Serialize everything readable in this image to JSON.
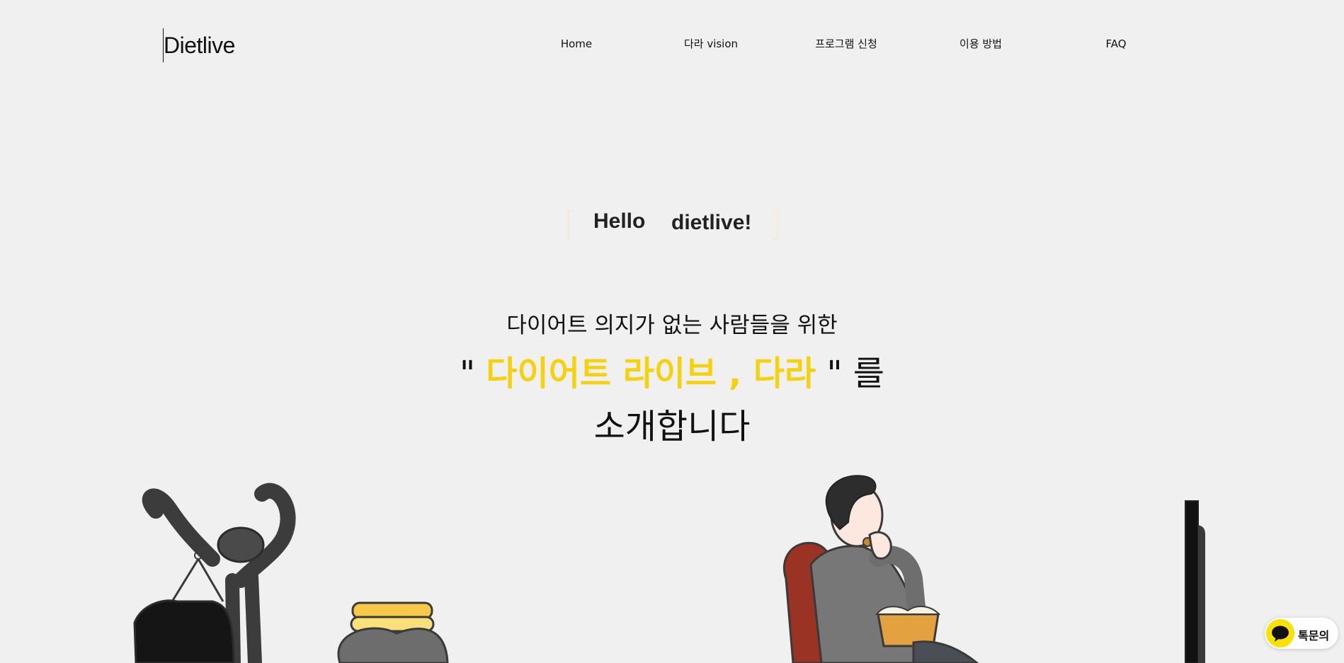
{
  "header": {
    "logo": "Dietlive",
    "nav": [
      "Home",
      "다라 vision",
      "프로그램 신청",
      "이용 방법",
      "FAQ"
    ]
  },
  "hero": {
    "bracket_open": "[",
    "bracket_close": "]",
    "hello_word1": "Hello",
    "hello_word2": "dietlive!",
    "line1": "다이어트 의지가 없는 사람들을 위한",
    "line2_prefix": "\" ",
    "line2_accent": "다이어트 라이브 , 다라",
    "line2_suffix": " \" 를",
    "line3": "소개합니다"
  },
  "chat": {
    "label": "톡문의"
  },
  "colors": {
    "accent": "#f5d10e",
    "background": "#f0f0f0",
    "bracket": "#f6ebd0",
    "kakao": "#fae100"
  }
}
